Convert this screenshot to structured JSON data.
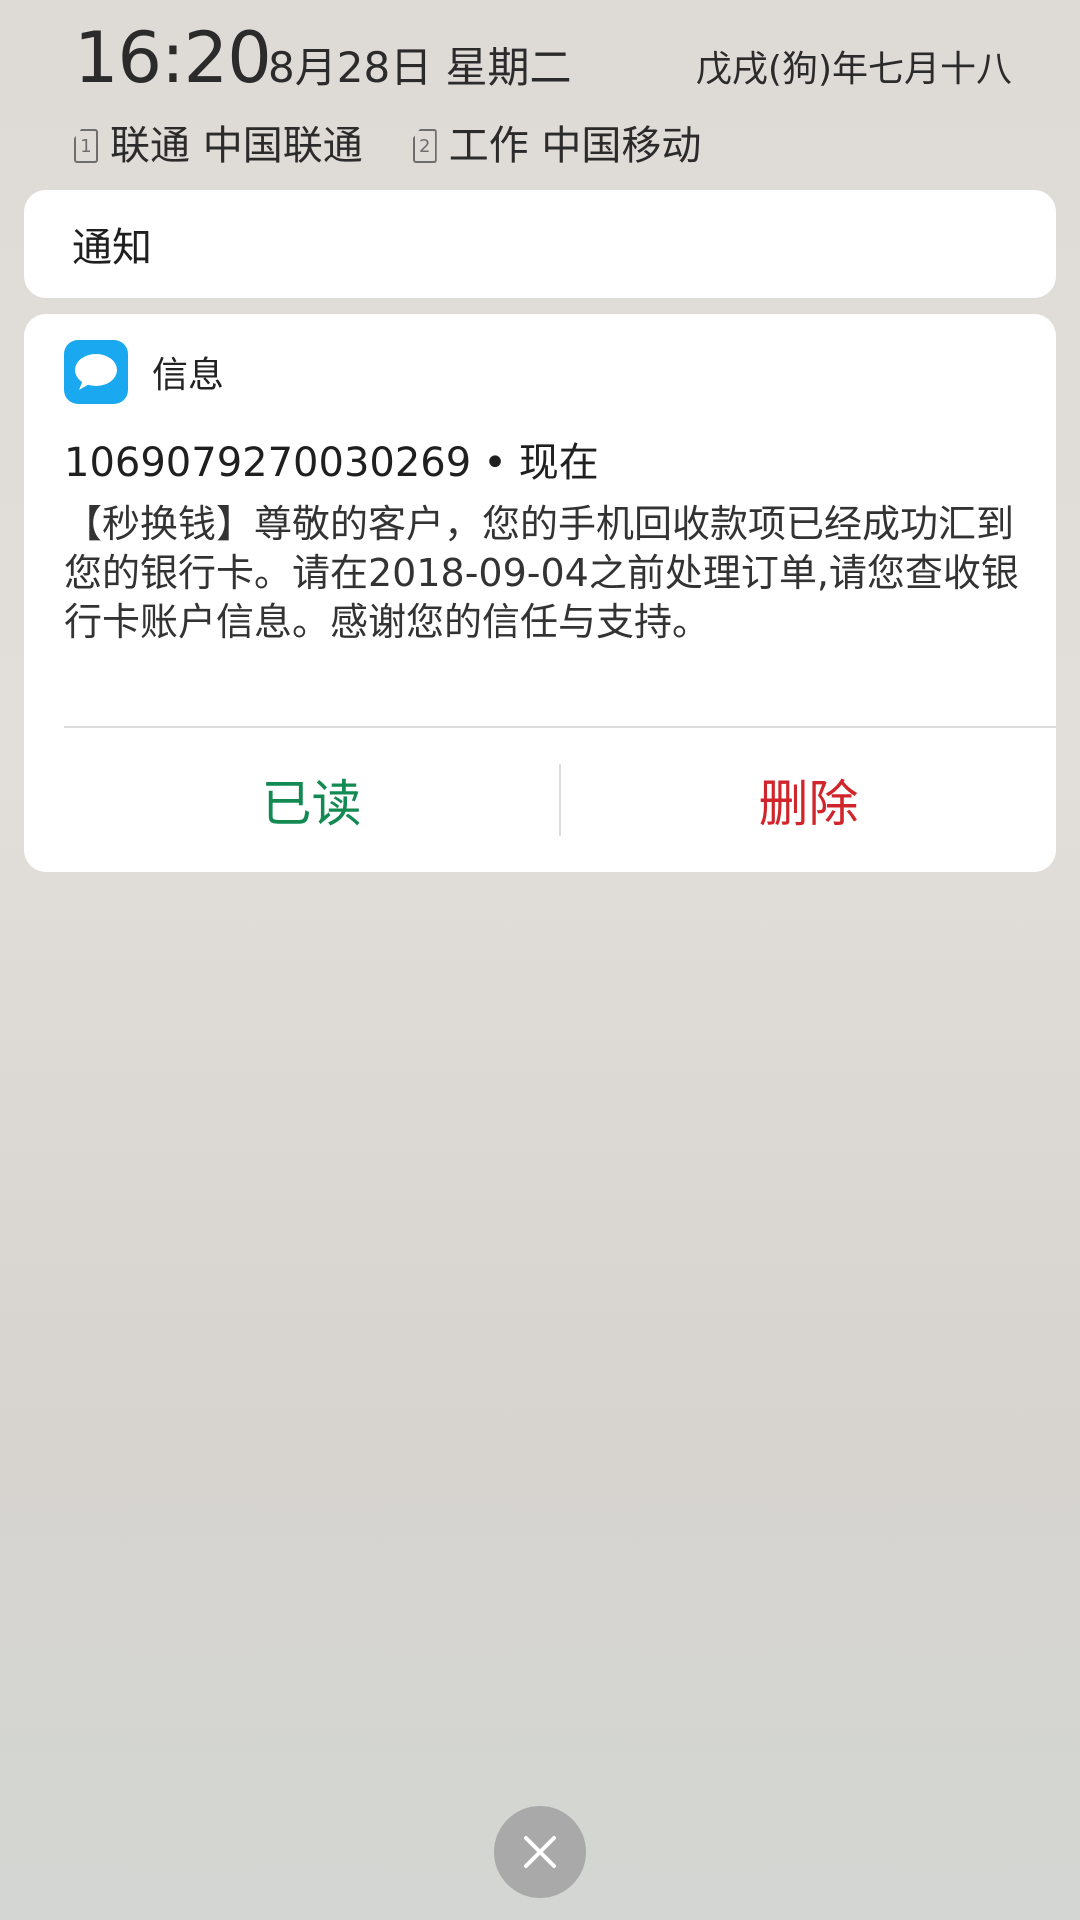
{
  "status": {
    "time": "16:20",
    "date": "8月28日 星期二",
    "lunar": "戊戌(狗)年七月十八"
  },
  "sims": [
    {
      "slot": "1",
      "label": "联通 中国联通"
    },
    {
      "slot": "2",
      "label": "工作 中国移动"
    }
  ],
  "notifications": {
    "header_title": "通知"
  },
  "message": {
    "app_name": "信息",
    "app_icon": "message-bubble-icon",
    "sender": "1069079270030269",
    "separator": "•",
    "time": "现在",
    "body": "【秒换钱】尊敬的客户，您的手机回收款项已经成功汇到您的银行卡。请在2018-09-04之前处理订单,请您查收银行卡账户信息。感谢您的信任与支持。"
  },
  "actions": {
    "read_label": "已读",
    "delete_label": "删除"
  },
  "colors": {
    "app_icon_bg": "#1aa9f0",
    "read": "#138a52",
    "delete": "#d0262b",
    "close_bg": "#a9a9a9"
  },
  "close_button": {
    "icon": "close-icon"
  }
}
